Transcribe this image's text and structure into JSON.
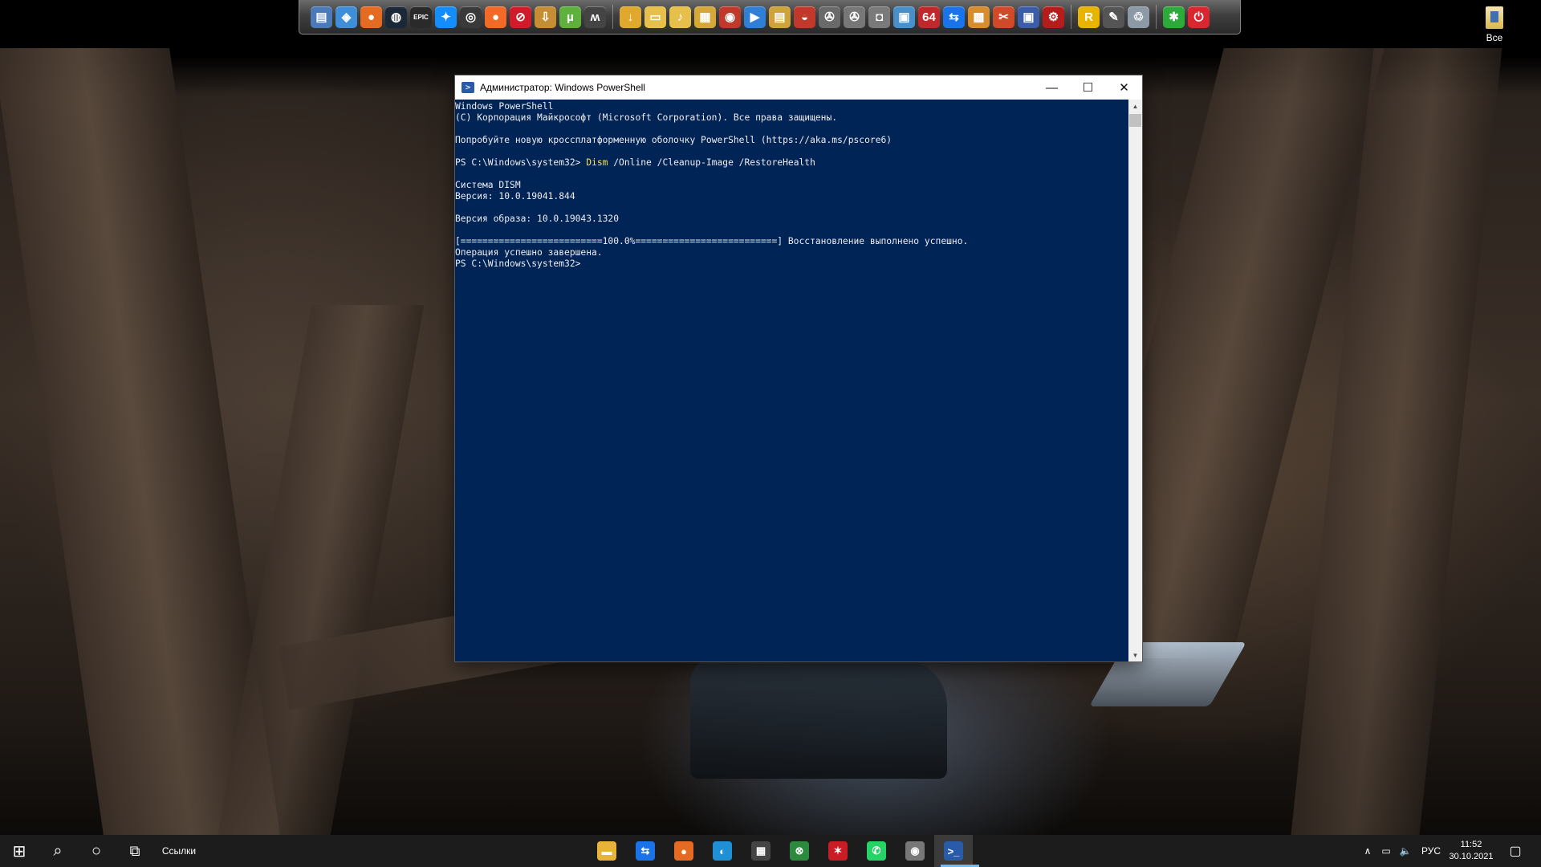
{
  "dock": {
    "icons": [
      {
        "name": "computer-icon",
        "glyph": "▤",
        "color": "#4a7ab8"
      },
      {
        "name": "network-icon",
        "glyph": "◈",
        "color": "#3f8fd8"
      },
      {
        "name": "firefox-icon",
        "glyph": "●",
        "color": "#e66b22"
      },
      {
        "name": "steam-icon",
        "glyph": "◍",
        "color": "#1b2838"
      },
      {
        "name": "epic-games-icon",
        "glyph": "EPIC",
        "color": "#2a2a2a"
      },
      {
        "name": "battlenet-icon",
        "glyph": "✦",
        "color": "#148eff"
      },
      {
        "name": "uplay-icon",
        "glyph": "◎",
        "color": "#3a3a3a"
      },
      {
        "name": "origin-icon",
        "glyph": "●",
        "color": "#f26a25"
      },
      {
        "name": "opera-icon",
        "glyph": "⊘",
        "color": "#d11a2a"
      },
      {
        "name": "downloads-icon",
        "glyph": "⇩",
        "color": "#c58e35"
      },
      {
        "name": "utorrent-icon",
        "glyph": "µ",
        "color": "#5fb13d"
      },
      {
        "name": "mu-icon",
        "glyph": "ʍ",
        "color": "#444"
      },
      {
        "name": "sep",
        "glyph": "",
        "color": ""
      },
      {
        "name": "folder-download-icon",
        "glyph": "↓",
        "color": "#e0a92d"
      },
      {
        "name": "documents-icon",
        "glyph": "▭",
        "color": "#e6c04a"
      },
      {
        "name": "folder-music-icon",
        "glyph": "♪",
        "color": "#e6c04a"
      },
      {
        "name": "pictures-icon",
        "glyph": "▦",
        "color": "#d6a83a"
      },
      {
        "name": "eye-icon",
        "glyph": "◉",
        "color": "#c0392b"
      },
      {
        "name": "play-icon",
        "glyph": "▶",
        "color": "#2f7fd6"
      },
      {
        "name": "notes-icon",
        "glyph": "▤",
        "color": "#cfa23a"
      },
      {
        "name": "controller-icon",
        "glyph": "◒",
        "color": "#c0392b"
      },
      {
        "name": "reel-icon",
        "glyph": "✇",
        "color": "#6a6a6a"
      },
      {
        "name": "film-icon",
        "glyph": "✇",
        "color": "#777"
      },
      {
        "name": "camera-icon",
        "glyph": "◘",
        "color": "#7a7a7a"
      },
      {
        "name": "monitor-icon",
        "glyph": "▣",
        "color": "#4a90c8"
      },
      {
        "name": "aida64-icon",
        "glyph": "64",
        "color": "#c0282b"
      },
      {
        "name": "teamviewer-icon",
        "glyph": "⇆",
        "color": "#1a73e8"
      },
      {
        "name": "package-icon",
        "glyph": "▩",
        "color": "#d98c2b"
      },
      {
        "name": "tools-icon",
        "glyph": "✂",
        "color": "#d04a2a"
      },
      {
        "name": "save-icon",
        "glyph": "▣",
        "color": "#3b5ca8"
      },
      {
        "name": "gear-red-icon",
        "glyph": "⚙",
        "color": "#b51d1d"
      },
      {
        "name": "sep",
        "glyph": "",
        "color": ""
      },
      {
        "name": "rockstar-icon",
        "glyph": "R",
        "color": "#e8b400"
      },
      {
        "name": "brush-icon",
        "glyph": "✎",
        "color": "#555"
      },
      {
        "name": "recycle-bin-icon",
        "glyph": "♲",
        "color": "#8c9aa8"
      },
      {
        "name": "sep",
        "glyph": "",
        "color": ""
      },
      {
        "name": "green-power-icon",
        "glyph": "✱",
        "color": "#2eaa3b"
      },
      {
        "name": "power-icon",
        "glyph": "⏻",
        "color": "#d9262f"
      }
    ]
  },
  "desktop_icon": {
    "label": "Все"
  },
  "window": {
    "title": "Администратор: Windows PowerShell",
    "minimize_glyph": "—",
    "maximize_glyph": "☐",
    "close_glyph": "✕",
    "lines": [
      {
        "text": "Windows PowerShell"
      },
      {
        "text": "(C) Корпорация Майкрософт (Microsoft Corporation). Все права защищены."
      },
      {
        "text": ""
      },
      {
        "text": "Попробуйте новую кроссплатформенную оболочку PowerShell (https://aka.ms/pscore6)"
      },
      {
        "text": ""
      },
      {
        "prefix": "PS C:\\Windows\\system32> ",
        "cmd": "Dism",
        "rest": " /Online /Cleanup-Image /RestoreHealth"
      },
      {
        "text": ""
      },
      {
        "text": "Cистема DISM"
      },
      {
        "text": "Версия: 10.0.19041.844"
      },
      {
        "text": ""
      },
      {
        "text": "Версия образа: 10.0.19043.1320"
      },
      {
        "text": ""
      },
      {
        "text": "[==========================100.0%==========================] Восстановление выполнено успешно."
      },
      {
        "text": "Операция успешно завершена."
      },
      {
        "text": "PS C:\\Windows\\system32>"
      }
    ]
  },
  "taskbar": {
    "start_glyph": "⊞",
    "search_glyph": "⌕",
    "cortana_glyph": "○",
    "taskview_glyph": "⧉",
    "links_label": "Ссылки",
    "apps": [
      {
        "name": "file-explorer-icon",
        "glyph": "▬",
        "color": "#e8b33a"
      },
      {
        "name": "teamviewer-icon",
        "glyph": "⇆",
        "color": "#1a73e8"
      },
      {
        "name": "firefox-icon",
        "glyph": "●",
        "color": "#e66b22"
      },
      {
        "name": "edge-icon",
        "glyph": "◐",
        "color": "#1f8fd6"
      },
      {
        "name": "store-icon",
        "glyph": "▦",
        "color": "#444"
      },
      {
        "name": "xbox-icon",
        "glyph": "⊗",
        "color": "#2b8a3e"
      },
      {
        "name": "palm-icon",
        "glyph": "✶",
        "color": "#c81d25"
      },
      {
        "name": "whatsapp-icon",
        "glyph": "✆",
        "color": "#25d366"
      },
      {
        "name": "webcam-icon",
        "glyph": "◉",
        "color": "#777"
      },
      {
        "name": "powershell-icon",
        "glyph": ">_",
        "color": "#2a5ba8"
      }
    ],
    "tray": {
      "chevron": "∧",
      "network_glyph": "▭",
      "volume_glyph": "🔈",
      "language": "РУС",
      "time": "11:52",
      "date": "30.10.2021",
      "notification_glyph": "▢"
    }
  }
}
